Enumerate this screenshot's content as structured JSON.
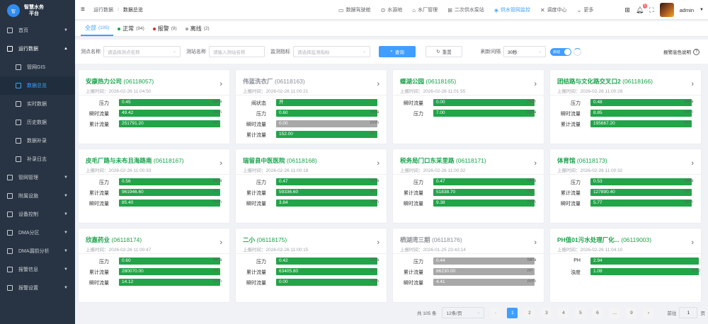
{
  "brand": {
    "line1": "智慧水务",
    "line2": "平台",
    "logo": "智"
  },
  "sidebar": [
    {
      "label": "首页",
      "icon": "grid-icon",
      "type": "top"
    },
    {
      "label": "运行数据",
      "icon": "monitor-icon",
      "type": "open"
    },
    {
      "label": "管网GIS",
      "icon": "gis-icon",
      "type": "sub"
    },
    {
      "label": "数据总览",
      "icon": "overview-icon",
      "type": "sub-active"
    },
    {
      "label": "实时数据",
      "icon": "realtime-icon",
      "type": "sub"
    },
    {
      "label": "历史数据",
      "icon": "history-icon",
      "type": "sub"
    },
    {
      "label": "数据补录",
      "icon": "supplement-icon",
      "type": "sub"
    },
    {
      "label": "补录日志",
      "icon": "log-icon",
      "type": "sub"
    },
    {
      "label": "管网管理",
      "icon": "pipe-icon",
      "type": "top"
    },
    {
      "label": "附属设施",
      "icon": "facility-icon",
      "type": "top"
    },
    {
      "label": "设备控制",
      "icon": "control-icon",
      "type": "top"
    },
    {
      "label": "DMA分区",
      "icon": "dma-icon",
      "type": "top"
    },
    {
      "label": "DMA漏损分析",
      "icon": "leak-icon",
      "type": "top"
    },
    {
      "label": "报警信息",
      "icon": "alarm-icon",
      "type": "top"
    },
    {
      "label": "报警设置",
      "icon": "settings-icon",
      "type": "top"
    }
  ],
  "breadcrumb": {
    "parent": "运行数据",
    "sep": "/",
    "current": "数据总览"
  },
  "top_links": [
    {
      "label": "数据驾驶舱",
      "icon": "▭"
    },
    {
      "label": "水源地",
      "icon": "⊙"
    },
    {
      "label": "水厂管理",
      "icon": "⌂"
    },
    {
      "label": "二次供水泵站",
      "icon": "⊞"
    },
    {
      "label": "供水管网监控",
      "icon": "◈",
      "active": true
    },
    {
      "label": "调度中心",
      "icon": "✕"
    },
    {
      "label": "更多",
      "icon": "⌄"
    }
  ],
  "user": {
    "name": "admin",
    "notifications": "1"
  },
  "tabs": [
    {
      "label": "全部",
      "count": "(105)",
      "active": true,
      "dot": ""
    },
    {
      "label": "正常",
      "count": "(94)",
      "dot": "#16a34a"
    },
    {
      "label": "报警",
      "count": "(9)",
      "dot": "#dc2626"
    },
    {
      "label": "离线",
      "count": "(2)",
      "dot": "#9ca3af"
    }
  ],
  "filter": {
    "site_name_label": "测点名称",
    "site_name_placeholder": "请选择测点名称",
    "station_label": "测站名称",
    "station_placeholder": "请输入测站名称",
    "metric_label": "监测指标",
    "metric_placeholder": "请选择监测指标",
    "search": "查询",
    "reset": "重置",
    "refresh_label": "刷新间隔",
    "refresh_value": "30秒",
    "switch_text": "启动",
    "help": "报警底色说明"
  },
  "cards": [
    {
      "name": "安康热力公司",
      "code": "(06118057)",
      "time": "上报时间：2026-02-26 11:04:50",
      "status": "normal",
      "rows": [
        {
          "label": "压力",
          "value": "0.45",
          "unit": "MPa"
        },
        {
          "label": "瞬时流量",
          "value": "49.42",
          "unit": "m³/h"
        },
        {
          "label": "累计流量",
          "value": "251791.20",
          "unit": "m³"
        }
      ]
    },
    {
      "name": "伟蓝洗衣厂",
      "code": "(06118163)",
      "time": "上报时间：2026-02-26 11:00:21",
      "status": "offline",
      "rows": [
        {
          "label": "阀状态",
          "value": "开",
          "unit": ""
        },
        {
          "label": "压力",
          "value": "0.60",
          "unit": "MPa"
        },
        {
          "label": "瞬时流量",
          "value": "0.00",
          "unit": "m³/h",
          "gray": true
        },
        {
          "label": "累计流量",
          "value": "152.00",
          "unit": "m³"
        }
      ]
    },
    {
      "name": "蝶湖公园",
      "code": "(06118165)",
      "time": "上报时间：2026-02-26 11:01:55",
      "status": "normal",
      "rows": [
        {
          "label": "瞬时流量",
          "value": "0.00",
          "unit": "m³/h"
        },
        {
          "label": "压力",
          "value": "7.00",
          "unit": "MPa"
        }
      ]
    },
    {
      "name": "团结路与文化路交叉口2",
      "code": "(06118166)",
      "time": "上报时间：2026-02-26 11:00:28",
      "status": "normal",
      "rows": [
        {
          "label": "压力",
          "value": "0.48",
          "unit": "MPa"
        },
        {
          "label": "瞬时流量",
          "value": "8.85",
          "unit": "m³/h"
        },
        {
          "label": "累计流量",
          "value": "195667.20",
          "unit": "m³"
        }
      ]
    },
    {
      "name": "皮毛厂路与未布且海路南",
      "code": "(06118167)",
      "time": "上报时间：2026-02-26 11:00:33",
      "status": "normal",
      "rows": [
        {
          "label": "压力",
          "value": "0.56",
          "unit": "MPa"
        },
        {
          "label": "累计流量",
          "value": "961946.60",
          "unit": "m³"
        },
        {
          "label": "瞬时流量",
          "value": "85.40",
          "unit": "m³/h"
        }
      ]
    },
    {
      "name": "瑞留县中医医院",
      "code": "(06118168)",
      "time": "上报时间：2026-02-26 11:00:18",
      "status": "normal",
      "rows": [
        {
          "label": "压力",
          "value": "0.47",
          "unit": "MPa"
        },
        {
          "label": "累计流量",
          "value": "59336.60",
          "unit": "m³"
        },
        {
          "label": "瞬时流量",
          "value": "3.84",
          "unit": "m³/h"
        }
      ]
    },
    {
      "name": "税务局门口东采里路",
      "code": "(06118171)",
      "time": "上报时间：2026-02-26 11:00:32",
      "status": "normal",
      "rows": [
        {
          "label": "压力",
          "value": "0.47",
          "unit": "MPa"
        },
        {
          "label": "累计流量",
          "value": "51838.70",
          "unit": "m³"
        },
        {
          "label": "瞬时流量",
          "value": "9.38",
          "unit": "m³/h"
        }
      ]
    },
    {
      "name": "体育馆",
      "code": "(06118173)",
      "time": "上报时间：2026-02-26 11:00:32",
      "status": "normal",
      "rows": [
        {
          "label": "压力",
          "value": "0.53",
          "unit": "MPa"
        },
        {
          "label": "累计流量",
          "value": "127890.40",
          "unit": "m³"
        },
        {
          "label": "瞬时流量",
          "value": "5.77",
          "unit": "m³/h"
        }
      ]
    },
    {
      "name": "欣嘉药业",
      "code": "(06118174)",
      "time": "上报时间：2026-02-26 11:00:47",
      "status": "normal",
      "rows": [
        {
          "label": "压力",
          "value": "0.60",
          "unit": "MPa"
        },
        {
          "label": "累计流量",
          "value": "280070.00",
          "unit": "m³"
        },
        {
          "label": "瞬时流量",
          "value": "14.12",
          "unit": "m³/h"
        }
      ]
    },
    {
      "name": "二小",
      "code": "(06118175)",
      "time": "上报时间：2026-02-26 11:00:15",
      "status": "normal",
      "rows": [
        {
          "label": "压力",
          "value": "0.42",
          "unit": "MPa"
        },
        {
          "label": "累计流量",
          "value": "63405.80",
          "unit": "m³"
        },
        {
          "label": "瞬时流量",
          "value": "0.00",
          "unit": "m³/h"
        }
      ]
    },
    {
      "name": "栖湖湾三期",
      "code": "(06118176)",
      "time": "上报时间：2026-01-25 23:43:14",
      "status": "offline",
      "rows": [
        {
          "label": "压力",
          "value": "0.44",
          "unit": "MPa",
          "gray": true
        },
        {
          "label": "累计流量",
          "value": "86230.00",
          "unit": "m³",
          "gray": true
        },
        {
          "label": "瞬时流量",
          "value": "4.41",
          "unit": "m³/h",
          "gray": true
        }
      ]
    },
    {
      "name": "PH值01污水处理厂化...",
      "code": "(06119003)",
      "time": "上报时间：2026-02-26 11:04:10",
      "status": "normal",
      "wide": true,
      "rows": [
        {
          "label": "PH",
          "value": "2.94",
          "unit": ""
        },
        {
          "label": "浊度",
          "value": "1.08",
          "unit": "NTU"
        }
      ]
    }
  ],
  "pager": {
    "total": "共 105 条",
    "page_size": "12条/页",
    "prev": "‹",
    "pages": [
      "1",
      "2",
      "3",
      "4",
      "5",
      "6",
      "…",
      "9"
    ],
    "next": "›",
    "goto_label": "前往",
    "goto_value": "1",
    "goto_suffix": "页"
  },
  "colors": {
    "accent": "#409eff",
    "normal": "#16a34a",
    "bar": "#22a448",
    "offline_bar": "#a8a8a8",
    "sidebar": "#283443"
  }
}
